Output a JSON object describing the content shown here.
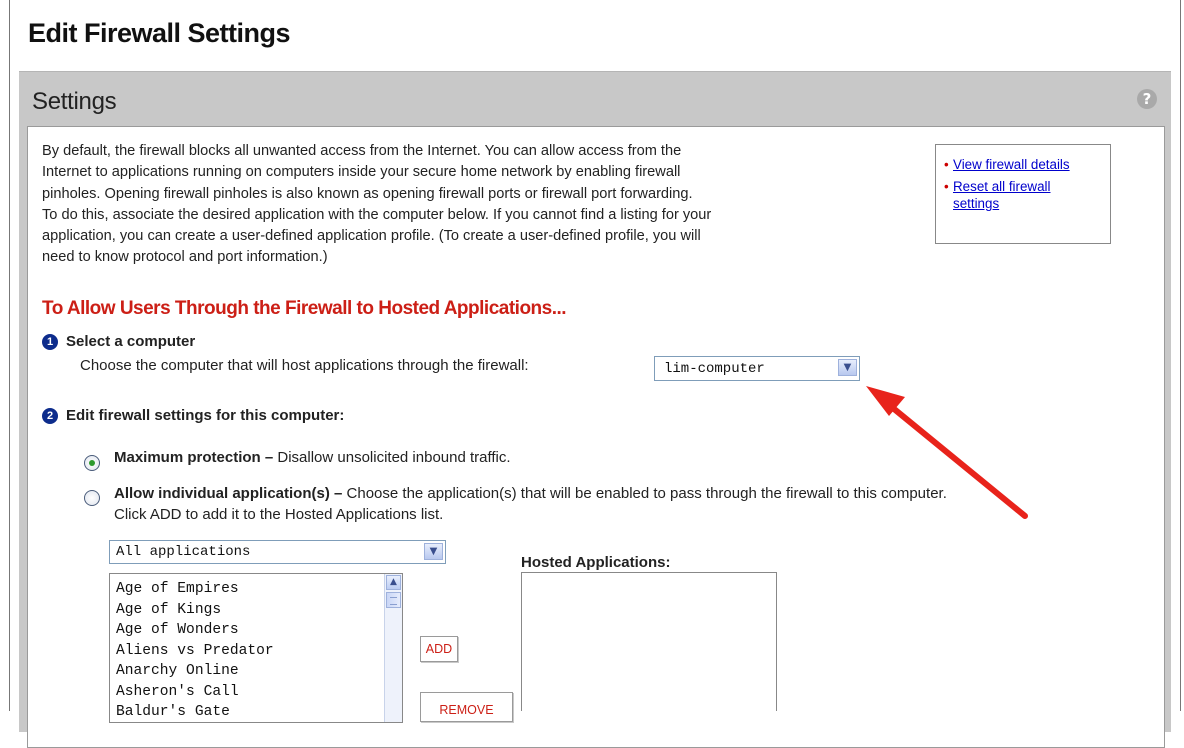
{
  "page": {
    "title": "Edit Firewall Settings"
  },
  "panel": {
    "title": "Settings",
    "help_icon": "question-mark-icon",
    "help_glyph": "?"
  },
  "intro": {
    "lines": [
      "By default, the firewall blocks all unwanted access from the Internet. You can allow access from the",
      "Internet to applications running on computers inside your secure home network by enabling firewall",
      "pinholes. Opening firewall pinholes is also known as opening firewall ports or firewall port forwarding.",
      "To do this, associate the desired application with the computer below. If you cannot find a listing for your",
      "application, you can create a user-defined application profile. (To create a user-defined profile, you will",
      "need to know protocol and port information.)"
    ]
  },
  "side_links": {
    "view_details": "View firewall details",
    "reset_line1": "Reset all firewall",
    "reset_line2": "settings",
    "bullet": "•"
  },
  "section": {
    "heading": "To Allow Users Through the Firewall to Hosted Applications..."
  },
  "step1": {
    "number": "1",
    "title": "Select a computer",
    "description": "Choose the computer that will host applications through the firewall:",
    "computer_select": {
      "selected": "lim-computer"
    }
  },
  "step2": {
    "number": "2",
    "title": "Edit firewall settings for this computer:",
    "option_max": {
      "label": "Maximum protection –",
      "description": " Disallow unsolicited inbound traffic.",
      "selected": true
    },
    "option_allow": {
      "label": "Allow individual application(s) –",
      "description": " Choose the application(s) that will be enabled to pass through the firewall to this computer.",
      "line2": "Click ADD to add it to the Hosted Applications list.",
      "selected": false
    }
  },
  "app_filter": {
    "selected": "All applications"
  },
  "app_list": {
    "items": [
      "Age of Empires",
      "Age of Kings",
      "Age of Wonders",
      "Aliens vs Predator",
      "Anarchy Online",
      "Asheron's Call",
      "Baldur's Gate"
    ]
  },
  "buttons": {
    "add": "ADD",
    "remove": "REMOVE"
  },
  "hosted": {
    "label": "Hosted Applications:",
    "items": []
  },
  "colors": {
    "heading_red": "#cc1f16",
    "link_blue": "#0000cc",
    "step_icon_blue": "#0d2c8c",
    "annotation_arrow": "#e8231b",
    "panel_gray": "#c8c8c8"
  },
  "icons": {
    "dropdown_arrow": "chevron-down-icon",
    "scroll_up": "chevron-up-icon",
    "annotation": "red-arrow-icon"
  }
}
